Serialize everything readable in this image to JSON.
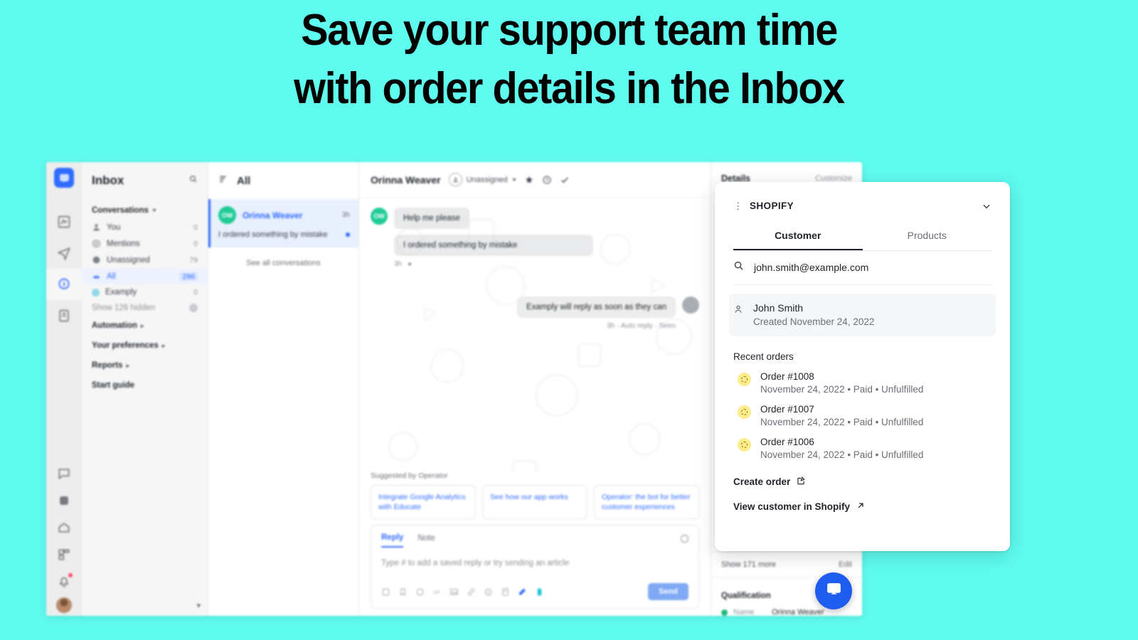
{
  "headline": {
    "line1": "Save your support team time",
    "line2": "with order details in the Inbox"
  },
  "colors": {
    "background": "#5ffbef",
    "brand_blue": "#2f6bff",
    "launcher_blue": "#1f5cf0",
    "avatar_green": "#1fcb96",
    "order_badge_yellow": "#ffec8a",
    "status_green": "#23b877"
  },
  "rail": {
    "logo": "intercom-logo-icon",
    "items": [
      {
        "name": "reports-icon"
      },
      {
        "name": "messages-icon"
      },
      {
        "name": "inbox-icon",
        "active": true
      },
      {
        "name": "articles-icon"
      }
    ],
    "bottom_items": [
      {
        "name": "chat-bubble-icon"
      },
      {
        "name": "apps-icon"
      },
      {
        "name": "home-icon"
      },
      {
        "name": "layout-icon"
      },
      {
        "name": "notifications-icon",
        "badge": true
      }
    ],
    "avatar": "user-avatar"
  },
  "nav": {
    "title": "Inbox",
    "search_icon": "search-icon",
    "section_label": "Conversations",
    "rows": [
      {
        "label": "You",
        "count": "0",
        "icon": "person-icon"
      },
      {
        "label": "Mentions",
        "count": "0",
        "icon": "at-icon"
      },
      {
        "label": "Unassigned",
        "count": "79",
        "icon": "unassigned-icon"
      },
      {
        "label": "All",
        "count": "296",
        "icon": "all-icon",
        "selected": true
      },
      {
        "label": "Examply",
        "count": "0",
        "icon": "team-icon"
      }
    ],
    "show_hidden": "Show 126 hidden",
    "links": [
      {
        "label": "Automation"
      },
      {
        "label": "Your preferences"
      },
      {
        "label": "Reports"
      },
      {
        "label": "Start guide"
      }
    ]
  },
  "conversation_list": {
    "header": "All",
    "sort_icon": "sort-icon",
    "item": {
      "avatar_initials": "OW",
      "name": "Orinna Weaver",
      "time": "3h",
      "snippet": "I ordered something by mistake"
    },
    "see_all": "See all conversations"
  },
  "chat": {
    "name": "Orinna Weaver",
    "assignee": "Unassigned",
    "header_icons": [
      "star-icon",
      "snooze-icon",
      "check-icon"
    ],
    "messages": [
      {
        "from": "customer",
        "text": "Help me please",
        "avatar_initials": "OW"
      },
      {
        "from": "customer",
        "text": "I ordered something by mistake",
        "meta": "3h"
      },
      {
        "from": "agent",
        "text": "Examply will reply as soon as they can",
        "meta": "3h · Auto reply · Seen"
      }
    ],
    "suggested_title": "Suggested by Operator",
    "suggested_chips": [
      "Integrate Google Analytics with Educate",
      "See how our app works",
      "Operator: the bot for better customer experiences"
    ],
    "composer": {
      "tabs": [
        "Reply",
        "Note"
      ],
      "active_tab": "Reply",
      "placeholder": "Type # to add a saved reply or try sending an article",
      "send_label": "Send",
      "toolbar_icons": [
        "emoji-icon",
        "saved-reply-icon",
        "gif-icon",
        "image-icon",
        "link-icon",
        "article-icon",
        "attachment-icon",
        "bold-icon",
        "app-icon"
      ]
    }
  },
  "details_panel": {
    "title": "Details",
    "customize": "Customize",
    "show_more": "Show 171 more",
    "edit": "Edit",
    "qualification": {
      "title": "Qualification",
      "key": "Name",
      "value": "Orinna Weaver"
    }
  },
  "shopify_card": {
    "drag_handle_icon": "drag-handle-icon",
    "title": "SHOPIFY",
    "collapse_icon": "chevron-down-icon",
    "tabs": [
      {
        "label": "Customer",
        "active": true
      },
      {
        "label": "Products",
        "active": false
      }
    ],
    "search": {
      "icon": "search-icon",
      "value": "john.smith@example.com"
    },
    "customer": {
      "icon": "person-icon",
      "name": "John Smith",
      "created": "Created November 24, 2022"
    },
    "recent_orders_label": "Recent orders",
    "orders": [
      {
        "id": "Order #1008",
        "meta": "November 24, 2022 • Paid • Unfulfilled",
        "status_icon": "pending-fulfillment-icon"
      },
      {
        "id": "Order #1007",
        "meta": "November 24, 2022 • Paid • Unfulfilled",
        "status_icon": "pending-fulfillment-icon"
      },
      {
        "id": "Order #1006",
        "meta": "November 24, 2022 • Paid • Unfulfilled",
        "status_icon": "pending-fulfillment-icon"
      }
    ],
    "actions": [
      {
        "label": "Create order",
        "icon": "edit-square-icon"
      },
      {
        "label": "View customer in Shopify",
        "icon": "external-link-icon"
      }
    ]
  },
  "messenger_launcher": {
    "icon": "messenger-bubble-icon"
  }
}
